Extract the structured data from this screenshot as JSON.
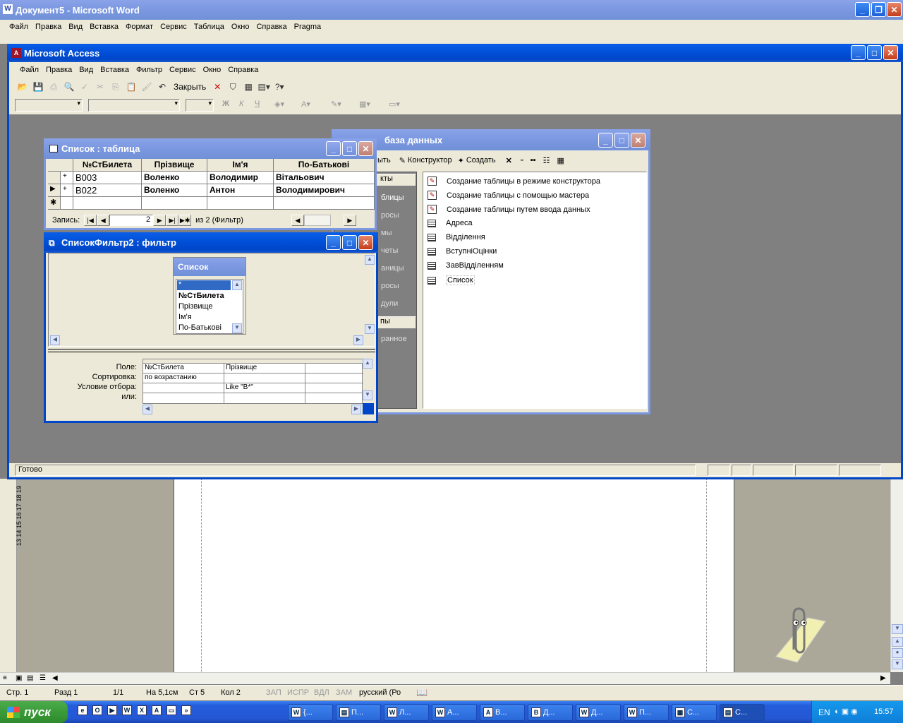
{
  "word": {
    "title": "Документ5 - Microsoft Word",
    "menu": [
      "Файл",
      "Правка",
      "Вид",
      "Вставка",
      "Формат",
      "Сервис",
      "Таблица",
      "Окно",
      "Справка",
      "Pragma"
    ],
    "ruler": [
      "13",
      "14",
      "15",
      "16",
      "17",
      "18",
      "19"
    ],
    "status": [
      "Стр. 1",
      "Разд 1",
      "1/1",
      "На 5,1см",
      "Ст 5",
      "Кол 2",
      "ЗАП",
      "ИСПР",
      "ВДЛ",
      "ЗАМ",
      "русский (Ро"
    ]
  },
  "access": {
    "title": "Microsoft Access",
    "menu": [
      "Файл",
      "Правка",
      "Вид",
      "Вставка",
      "Фильтр",
      "Сервис",
      "Окно",
      "Справка"
    ],
    "close_label": "Закрыть",
    "status": "Готово"
  },
  "table_window": {
    "title": "Список : таблица",
    "columns": [
      "№СтБилета",
      "Прізвище",
      "Ім'я",
      "По-Батькові"
    ],
    "rows": [
      [
        "В003",
        "Воленко",
        "Володимир",
        "Вітальович"
      ],
      [
        "В022",
        "Воленко",
        "Антон",
        "Володимирович"
      ]
    ],
    "nav_label": "Запись:",
    "record": "2",
    "of_label": "из  2 (Фильтр)"
  },
  "filter_window": {
    "title": "СписокФильтр2 : фильтр",
    "box_title": "Список",
    "fields": [
      "*",
      "№СтБилета",
      "Прізвище",
      "Ім'я",
      "По-Батькові"
    ],
    "row_labels": [
      "Поле:",
      "Сортировка:",
      "Условие отбора:",
      "или:"
    ],
    "grid": [
      [
        "№СтБилета",
        "Прізвище",
        ""
      ],
      [
        "по возрастанию",
        "",
        ""
      ],
      [
        "",
        "Like \"В*\"",
        ""
      ],
      [
        "",
        "",
        ""
      ]
    ]
  },
  "db_window": {
    "title": "база данных",
    "toolbar": {
      "open": "ыть",
      "designer": "Конструктор",
      "create": "Создать"
    },
    "sidebar": [
      "кты",
      "блицы",
      "росы",
      "мы",
      "четы",
      "аницы",
      "росы",
      "дули",
      "пы",
      "ранное"
    ],
    "items": [
      {
        "label": "Создание таблицы в режиме конструктора",
        "icon": "wizard-icon"
      },
      {
        "label": "Создание таблицы с помощью мастера",
        "icon": "wizard-icon"
      },
      {
        "label": "Создание таблицы путем ввода данных",
        "icon": "wizard-icon"
      },
      {
        "label": "Адреса",
        "icon": "table-icon"
      },
      {
        "label": "Відділення",
        "icon": "table-icon"
      },
      {
        "label": "ВступніОцінки",
        "icon": "table-icon"
      },
      {
        "label": "ЗавВідділенням",
        "icon": "table-icon"
      },
      {
        "label": "Список",
        "icon": "table-icon"
      }
    ]
  },
  "taskbar": {
    "start": "пуск",
    "tasks": [
      "{...",
      "П...",
      "Л...",
      "А...",
      "В...",
      "Д...",
      "Д...",
      "П...",
      "С...",
      "С..."
    ],
    "lang": "EN",
    "time": "15:57"
  }
}
